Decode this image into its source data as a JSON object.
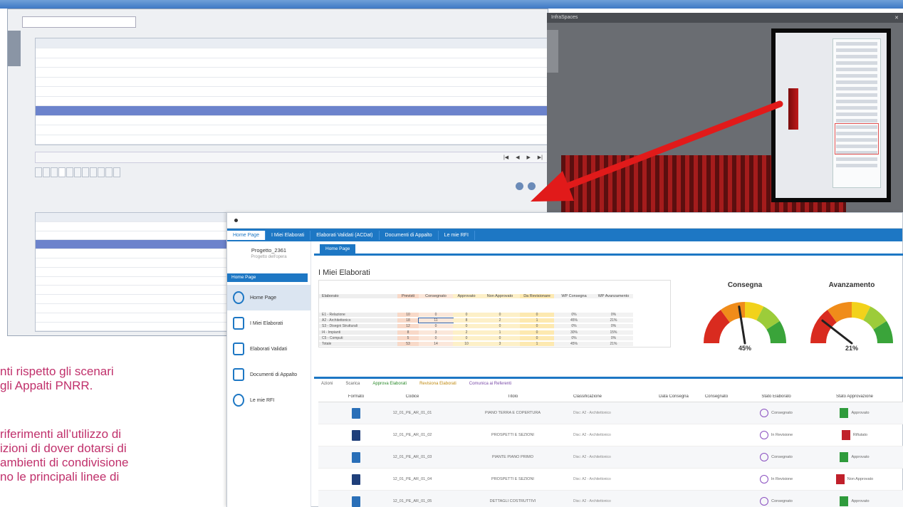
{
  "slide": {
    "para1": [
      "nti rispetto gli scenari",
      "gli Appalti PNRR."
    ],
    "para2": [
      "riferimenti all’utilizzo di",
      "izioni di dover dotarsi di",
      "ambienti di condivisione",
      "no le principali linee di"
    ]
  },
  "viewer": {
    "title": "InfraSpaces"
  },
  "front": {
    "nav": [
      "Home Page",
      "I Miei Elaborati",
      "Elaborati Validati (ACDat)",
      "Documenti di Appalto",
      "Le mie RFI"
    ],
    "project_name": "Progetto_2361",
    "project_sub": "Progetto dell'opera",
    "menu_head": "Home Page",
    "menu": [
      "Home Page",
      "I Miei Elaborati",
      "Elaborati Validati",
      "Documenti di Appalto",
      "Le mie RFI"
    ],
    "subtab": "Home Page",
    "section_title": "I Miei Elaborati",
    "summary_headers": [
      "Elaborato",
      "Previsti",
      "Consegnato",
      "Approvato",
      "Non Approvato",
      "Da Revisionare",
      "WP Consegna",
      "WP Avanzamento"
    ],
    "summary_rows": [
      [
        "E1 - Relazione",
        "10",
        "0",
        "0",
        "0",
        "0",
        "0%",
        "0%"
      ],
      [
        "A2 - Architettonico",
        "18",
        "11",
        "8",
        "2",
        "1",
        "45%",
        "21%"
      ],
      [
        "S3 - Disegni Strutturali",
        "12",
        "0",
        "0",
        "0",
        "0",
        "0%",
        "0%"
      ],
      [
        "I4 - Impianti",
        "8",
        "3",
        "2",
        "1",
        "0",
        "30%",
        "15%"
      ],
      [
        "C5 - Computi",
        "5",
        "0",
        "0",
        "0",
        "0",
        "0%",
        "0%"
      ],
      [
        "Totale",
        "53",
        "14",
        "10",
        "3",
        "1",
        "45%",
        "21%"
      ]
    ],
    "gauges": [
      {
        "title": "Consegna",
        "value": 45,
        "label": "45%"
      },
      {
        "title": "Avanzamento",
        "value": 21,
        "label": "21%"
      }
    ],
    "toolbar": [
      "Azioni",
      "Scarica",
      "Approva Elaborati",
      "Revisiona Elaborati",
      "Comunica ai Referenti"
    ],
    "table_headers": [
      "Formato",
      "Codice",
      "Titolo",
      "Classificazione",
      "Data Consegna",
      "Consegnato",
      "Stato Elaborato",
      "Stato Approvazione"
    ],
    "table_rows": [
      {
        "fmt": "blue",
        "code": "12_01_PE_AR_01_01",
        "title": "PIANO TERRA E COPERTURA",
        "class": "Disc: A2 - Architettonico",
        "status": "Consegnato",
        "appr": "green",
        "appr_label": "Approvato"
      },
      {
        "fmt": "navy",
        "code": "12_01_PE_AR_01_02",
        "title": "PROSPETTI E SEZIONI",
        "class": "Disc: A2 - Architettonico",
        "status": "In Revisione",
        "appr": "red",
        "appr_label": "Rifiutato"
      },
      {
        "fmt": "blue",
        "code": "12_01_PE_AR_01_03",
        "title": "PIANTE PIANO PRIMO",
        "class": "Disc: A2 - Architettonico",
        "status": "Consegnato",
        "appr": "green",
        "appr_label": "Approvato"
      },
      {
        "fmt": "navy",
        "code": "12_01_PE_AR_01_04",
        "title": "PROSPETTI E SEZIONI",
        "class": "Disc: A2 - Architettonico",
        "status": "In Revisione",
        "appr": "red",
        "appr_label": "Non Approvato"
      },
      {
        "fmt": "blue",
        "code": "12_01_PE_AR_01_05",
        "title": "DETTAGLI COSTRUTTIVI",
        "class": "Disc: A2 - Architettonico",
        "status": "Consegnato",
        "appr": "green",
        "appr_label": "Approvato"
      }
    ]
  },
  "colors": {
    "accent": "#1d77c4",
    "arrow": "#e11a1a",
    "slide_text": "#c0306b"
  }
}
